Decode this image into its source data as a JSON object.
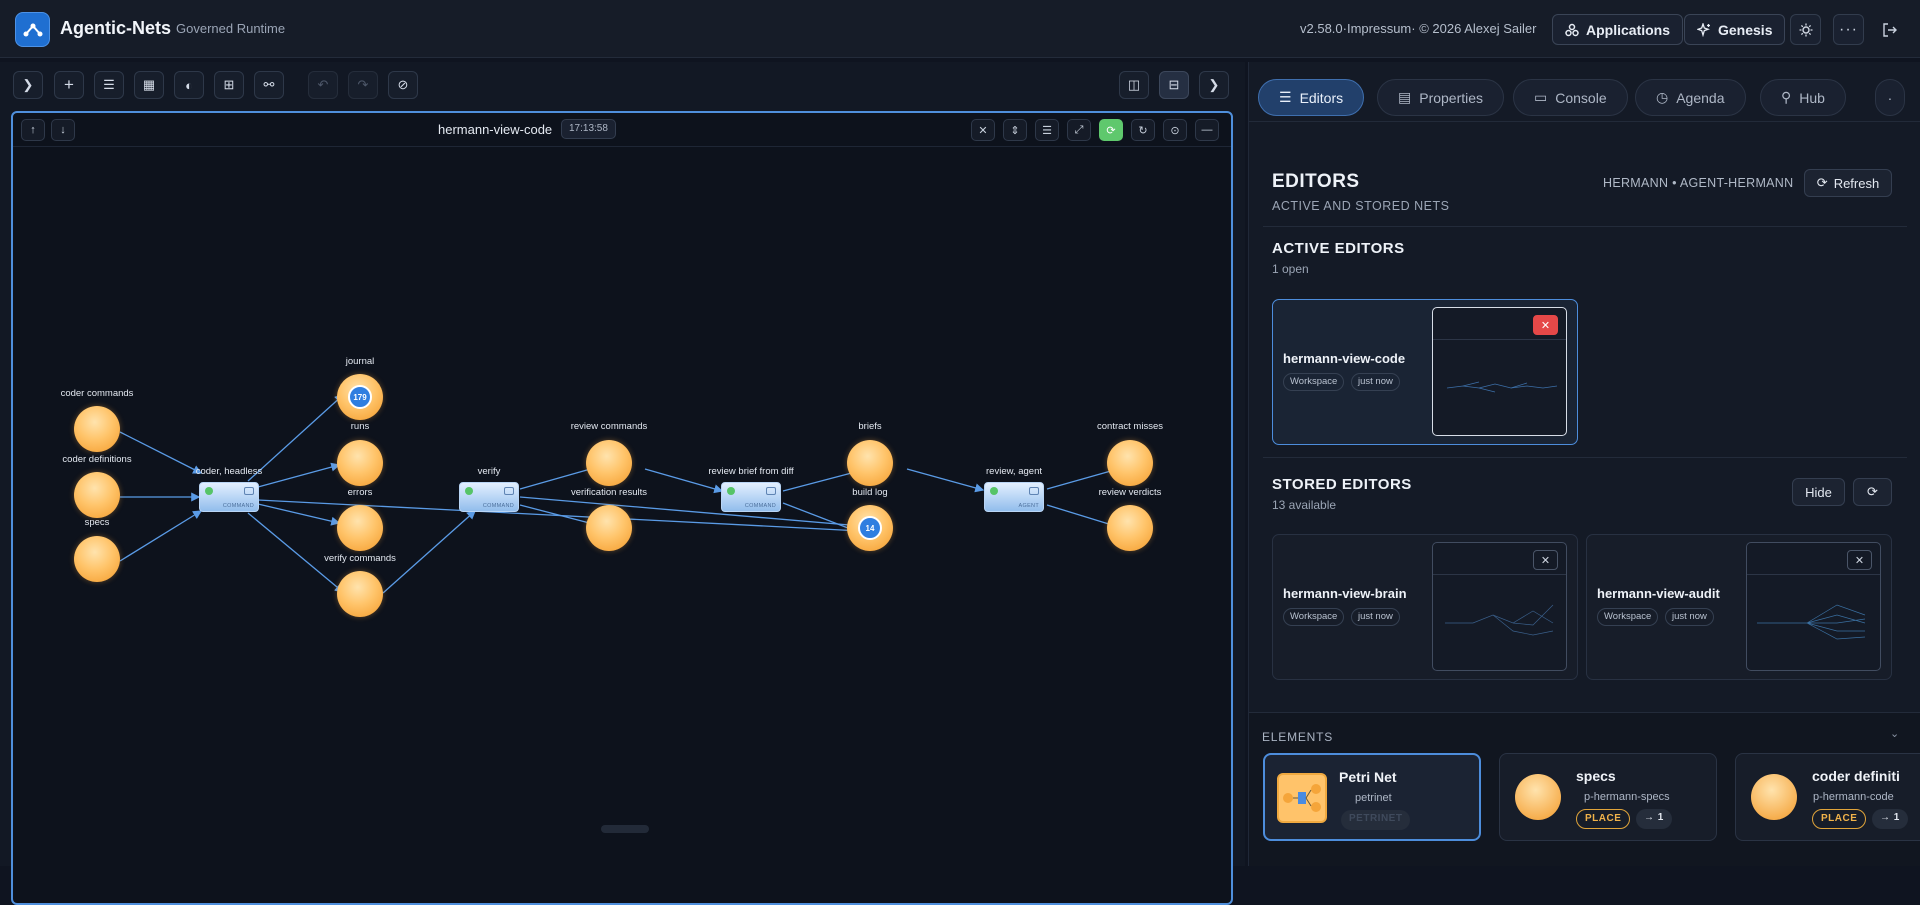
{
  "header": {
    "app_title": "Agentic-Nets",
    "app_subtitle": "Governed Runtime",
    "version_text": "v2.58.0·Impressum· © 2026 Alexej Sailer",
    "applications_label": "Applications",
    "genesis_label": "Genesis"
  },
  "canvas": {
    "title": "hermann-view-code",
    "time": "17:13:58",
    "places": [
      {
        "label": "coder commands"
      },
      {
        "label": "coder definitions"
      },
      {
        "label": "specs"
      },
      {
        "label": "journal",
        "count": "179"
      },
      {
        "label": "runs"
      },
      {
        "label": "errors"
      },
      {
        "label": "verify commands"
      },
      {
        "label": "review commands"
      },
      {
        "label": "verification results"
      },
      {
        "label": "briefs"
      },
      {
        "label": "build log",
        "count": "14"
      },
      {
        "label": "contract misses"
      },
      {
        "label": "review verdicts"
      }
    ],
    "transitions": [
      {
        "label": "coder, headless",
        "type": "COMMAND"
      },
      {
        "label": "verify",
        "type": "COMMAND"
      },
      {
        "label": "review brief from diff",
        "type": "COMMAND"
      },
      {
        "label": "review, agent",
        "type": "AGENT"
      }
    ]
  },
  "right_panel": {
    "tabs": [
      {
        "label": "Editors",
        "icon": "list-icon"
      },
      {
        "label": "Properties",
        "icon": "document-icon"
      },
      {
        "label": "Console",
        "icon": "terminal-icon"
      },
      {
        "label": "Agenda",
        "icon": "clock-icon"
      },
      {
        "label": "Hub",
        "icon": "hub-icon"
      }
    ],
    "editors_title": "EDITORS",
    "editors_subtitle": "ACTIVE AND STORED NETS",
    "user_label": "HERMANN • AGENT-HERMANN",
    "refresh_label": "Refresh",
    "active_title": "ACTIVE EDITORS",
    "active_count": "1 open",
    "active_editors": [
      {
        "name": "hermann-view-code",
        "kind": "Workspace",
        "when": "just now"
      }
    ],
    "stored_title": "STORED EDITORS",
    "stored_count": "13 available",
    "hide_label": "Hide",
    "stored_editors": [
      {
        "name": "hermann-view-brain",
        "kind": "Workspace",
        "when": "just now"
      },
      {
        "name": "hermann-view-audit",
        "kind": "Workspace",
        "when": "just now"
      }
    ],
    "elements_title": "ELEMENTS",
    "elements": [
      {
        "name": "Petri Net",
        "id": "petrinet",
        "chip": "PETRINET"
      },
      {
        "name": "specs",
        "id": "p-hermann-specs",
        "chip": "PLACE",
        "arrow": "→ 1"
      },
      {
        "name": "coder definiti",
        "id": "p-hermann-code",
        "chip": "PLACE",
        "arrow": "→ 1"
      }
    ]
  },
  "colors": {
    "accent": "#4d8ddc",
    "place": "#ffb347",
    "transition": "#a9cdf3",
    "running": "#5fc86d",
    "close_red": "#e54848"
  }
}
